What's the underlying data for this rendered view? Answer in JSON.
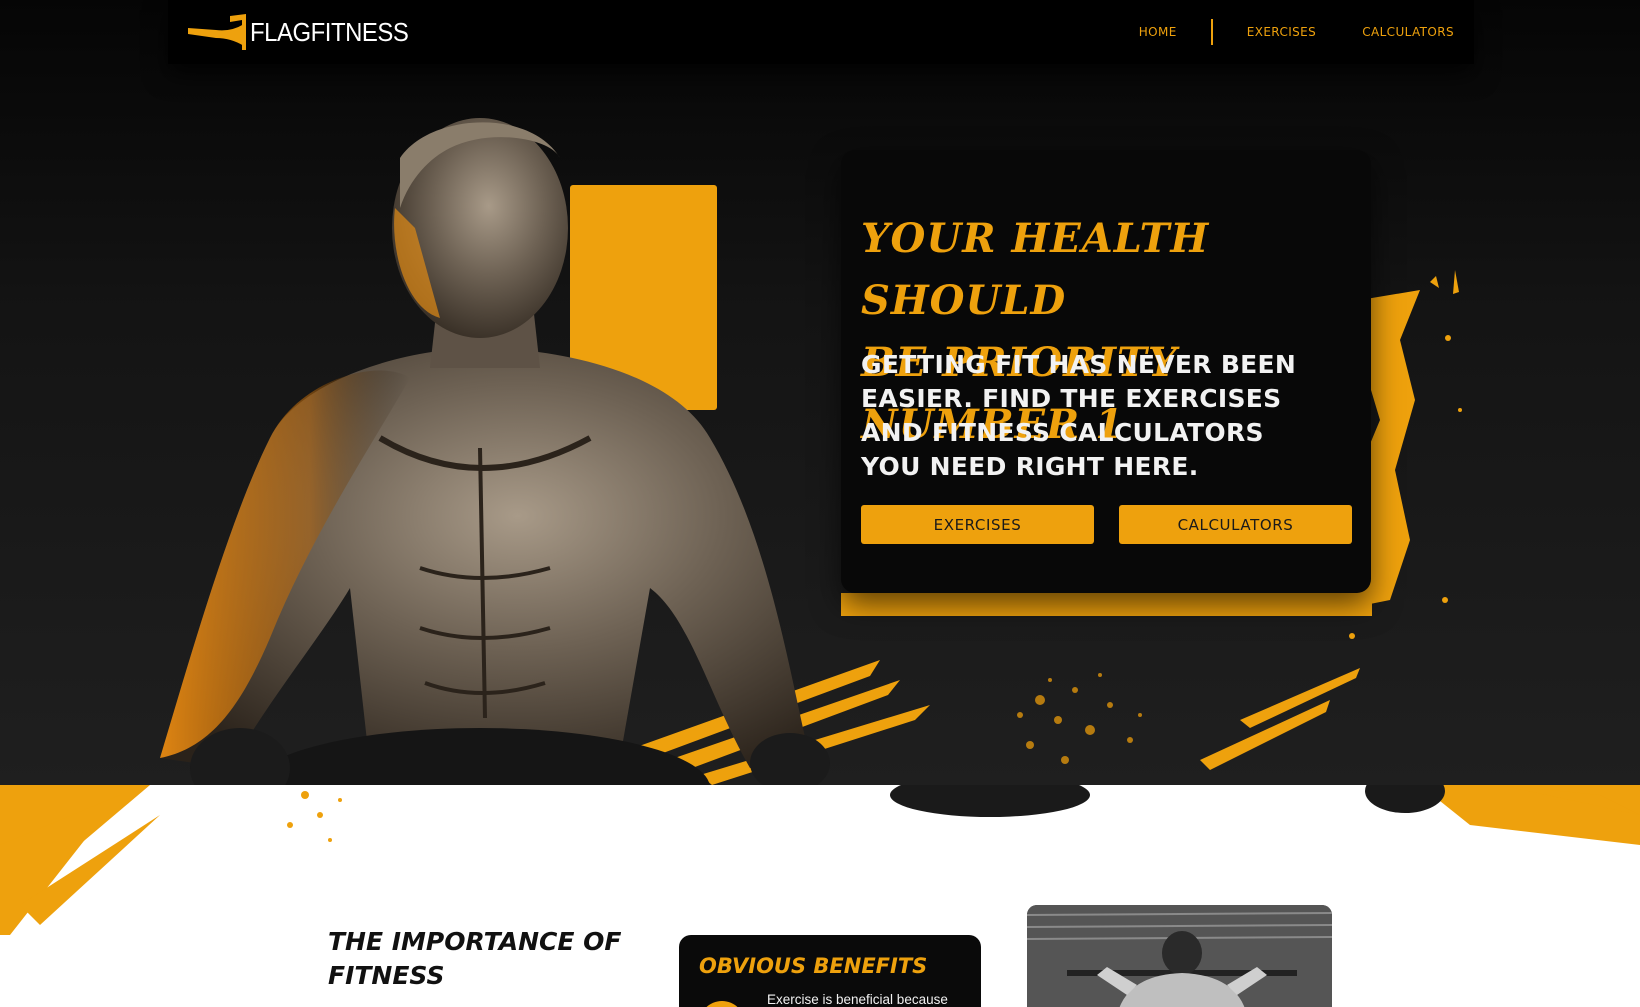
{
  "brand": {
    "name": "FLAGFITNESS",
    "logo_icon": "flag-logo-icon"
  },
  "nav": {
    "items": [
      {
        "label": "HOME"
      },
      {
        "label": "EXERCISES"
      },
      {
        "label": "CALCULATORS"
      }
    ]
  },
  "hero": {
    "title_line1": "YOUR HEALTH SHOULD",
    "title_line2": "BE PRIORITY NUMBER 1",
    "subtitle": "GETTING FIT HAS NEVER BEEN EASIER. FIND THE EXERCISES AND FITNESS CALCULATORS YOU NEED RIGHT HERE.",
    "buttons": [
      {
        "label": "EXERCISES"
      },
      {
        "label": "CALCULATORS"
      }
    ]
  },
  "importance": {
    "title_line1": "THE IMPORTANCE OF",
    "title_line2": "FITNESS"
  },
  "benefits": {
    "title": "OBVIOUS BENEFITS",
    "text": "Exercise is beneficial because"
  },
  "colors": {
    "accent": "#eea10d",
    "dark": "#080808",
    "hero_bg": "#1f1f1f"
  }
}
